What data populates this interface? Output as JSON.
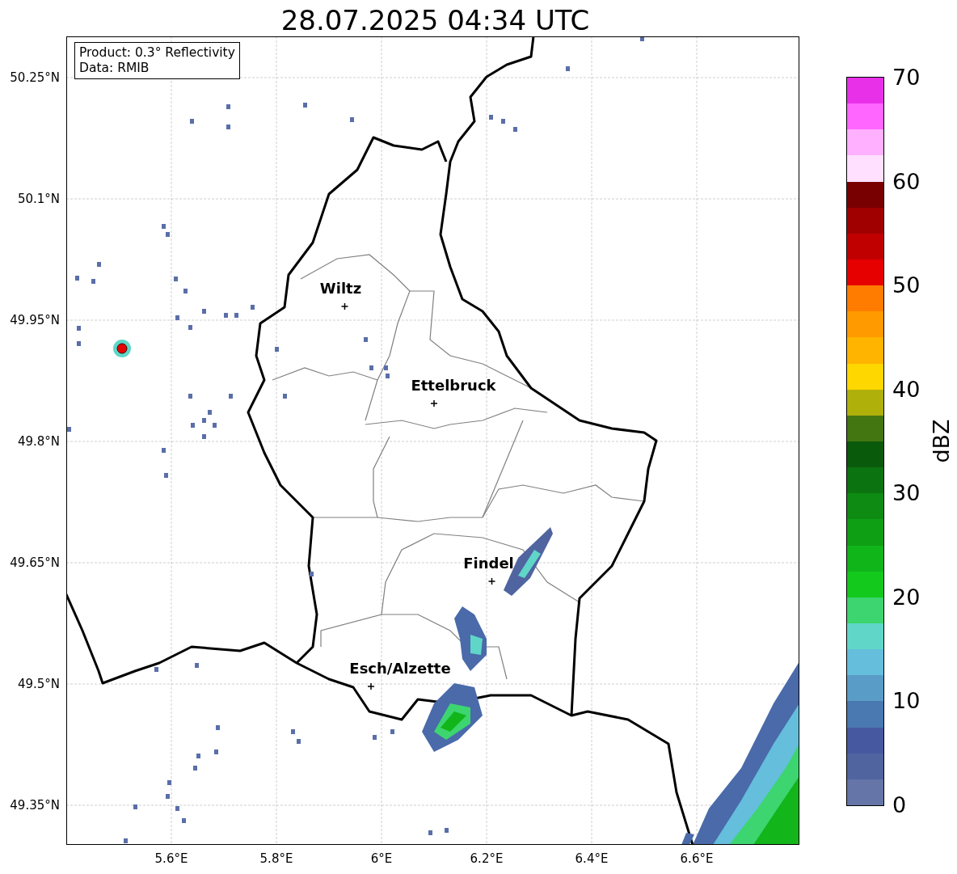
{
  "title": "28.07.2025 04:34 UTC",
  "info_box": [
    "Product: 0.3° Reflectivity",
    "Data: RMIB"
  ],
  "lat_ticks": [
    "50.25°N",
    "50.1°N",
    "49.95°N",
    "49.8°N",
    "49.65°N",
    "49.5°N",
    "49.35°N"
  ],
  "lon_ticks": [
    "5.6°E",
    "5.8°E",
    "6°E",
    "6.2°E",
    "6.4°E",
    "6.6°E"
  ],
  "cities": [
    {
      "name": "Wiltz"
    },
    {
      "name": "Ettelbruck"
    },
    {
      "name": "Findel"
    },
    {
      "name": "Esch/Alzette"
    }
  ],
  "colorbar": {
    "label": "dBZ",
    "ticks": [
      "70",
      "60",
      "50",
      "40",
      "30",
      "20",
      "10",
      "0"
    ],
    "bins": [
      {
        "color": "#6575a8"
      },
      {
        "color": "#5064a0"
      },
      {
        "color": "#4659a0"
      },
      {
        "color": "#4a78b0"
      },
      {
        "color": "#5a9cc8"
      },
      {
        "color": "#64bedc"
      },
      {
        "color": "#5fd6c8"
      },
      {
        "color": "#3dd56f"
      },
      {
        "color": "#12c91c"
      },
      {
        "color": "#10b51a"
      },
      {
        "color": "#0f9f14"
      },
      {
        "color": "#0e8b12"
      },
      {
        "color": "#0b7410"
      },
      {
        "color": "#0a5a0c"
      },
      {
        "color": "#437610"
      },
      {
        "color": "#b0b00a"
      },
      {
        "color": "#ffd700"
      },
      {
        "color": "#ffb400"
      },
      {
        "color": "#ff9a00"
      },
      {
        "color": "#ff7c00"
      },
      {
        "color": "#e60000"
      },
      {
        "color": "#c00000"
      },
      {
        "color": "#a00000"
      },
      {
        "color": "#780000"
      },
      {
        "color": "#ffe0ff"
      },
      {
        "color": "#ffb0ff"
      },
      {
        "color": "#ff66ff"
      },
      {
        "color": "#e930e9"
      }
    ]
  }
}
